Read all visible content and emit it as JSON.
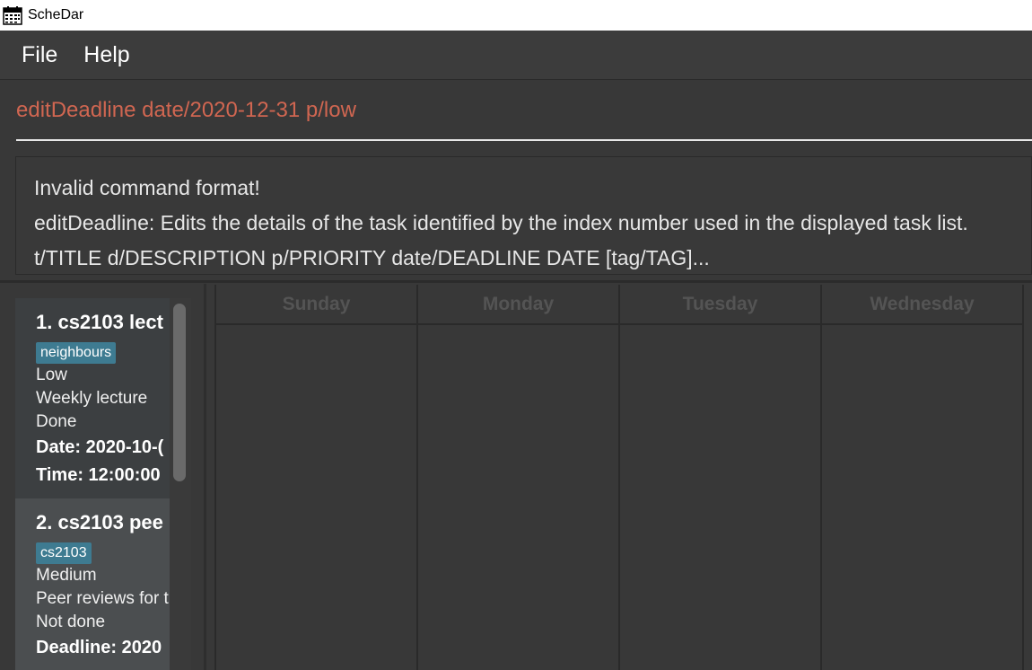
{
  "window": {
    "title": "ScheDar",
    "icon": "calendar-icon"
  },
  "menu": {
    "file": "File",
    "help": "Help"
  },
  "command": {
    "value": "editDeadline date/2020-12-31 p/low",
    "color": "#d06651"
  },
  "result": {
    "lines": [
      "Invalid command format!",
      "editDeadline: Edits the details of the task identified by the index number used in the displayed task list.",
      "t/TITLE d/DESCRIPTION p/PRIORITY date/DEADLINE DATE [tag/TAG]..."
    ]
  },
  "tasks": [
    {
      "title": "1.  cs2103 lect",
      "tag": "neighbours",
      "priority": "Low",
      "description": "Weekly lecture",
      "status": "Done",
      "date": "Date: 2020-10-(",
      "time": "Time: 12:00:00"
    },
    {
      "title": "2.  cs2103 pee",
      "tag": "cs2103",
      "priority": "Medium",
      "description": "Peer reviews for t",
      "status": "Not done",
      "deadline": "Deadline: 2020"
    }
  ],
  "calendar": {
    "days": [
      "Sunday",
      "Monday",
      "Tuesday",
      "Wednesday"
    ]
  }
}
